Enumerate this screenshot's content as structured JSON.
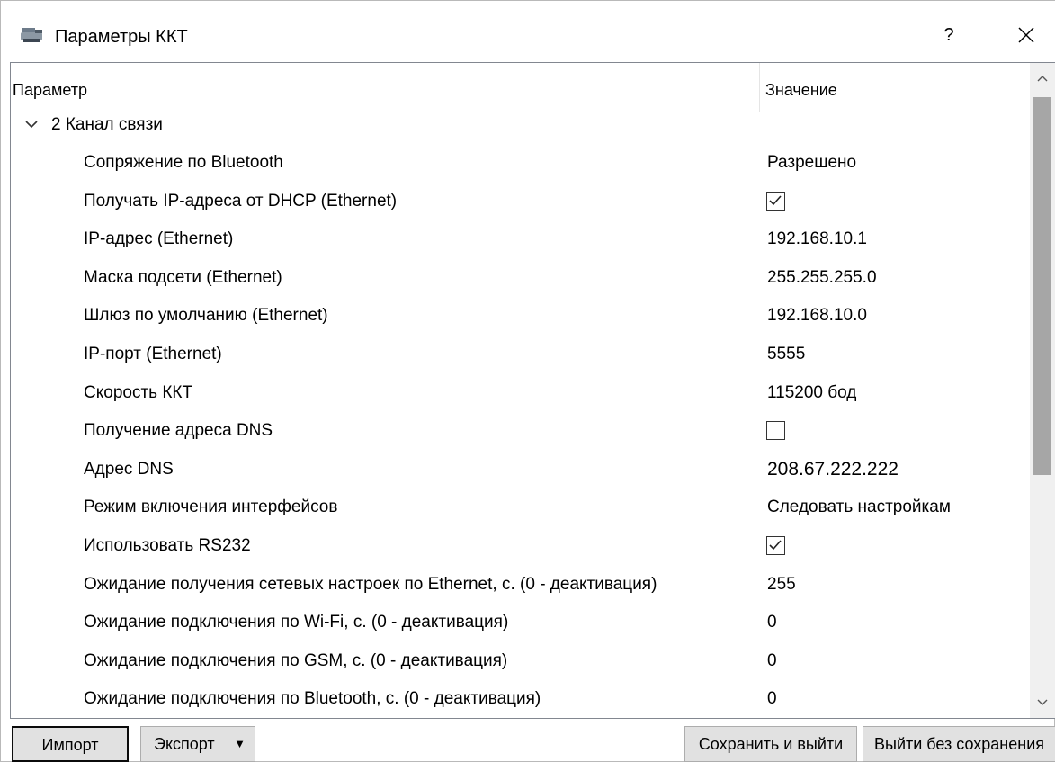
{
  "window": {
    "title": "Параметры ККТ",
    "help_label": "?",
    "close_label": "✕"
  },
  "table": {
    "columns": [
      "Параметр",
      "Значение"
    ],
    "group": {
      "label": "2 Канал связи",
      "expanded": true
    },
    "rows": [
      {
        "name": "Сопряжение по Bluetooth",
        "type": "text",
        "value": "Разрешено"
      },
      {
        "name": "Получать IP-адреса от DHCP (Ethernet)",
        "type": "checkbox",
        "checked": true
      },
      {
        "name": "IP-адрес (Ethernet)",
        "type": "text",
        "value": "192.168.10.1"
      },
      {
        "name": "Маска подсети (Ethernet)",
        "type": "text",
        "value": "255.255.255.0"
      },
      {
        "name": "Шлюз по умолчанию (Ethernet)",
        "type": "text",
        "value": "192.168.10.0"
      },
      {
        "name": "IP-порт (Ethernet)",
        "type": "text",
        "value": "5555"
      },
      {
        "name": "Скорость ККТ",
        "type": "text",
        "value": "115200 бод"
      },
      {
        "name": "Получение адреса DNS",
        "type": "checkbox",
        "checked": false
      },
      {
        "name": "Адрес DNS",
        "type": "text",
        "value": "208.67.222.222"
      },
      {
        "name": "Режим включения интерфейсов",
        "type": "text",
        "value": "Следовать настройкам"
      },
      {
        "name": "Использовать RS232",
        "type": "checkbox",
        "checked": true
      },
      {
        "name": "Ожидание получения сетевых настроек по Ethernet, с. (0 - деактивация)",
        "type": "text",
        "value": "255"
      },
      {
        "name": "Ожидание подключения по Wi-Fi, с. (0 - деактивация)",
        "type": "text",
        "value": "0"
      },
      {
        "name": "Ожидание подключения по GSM, с. (0 - деактивация)",
        "type": "text",
        "value": "0"
      },
      {
        "name": "Ожидание подключения по Bluetooth, с. (0 - деактивация)",
        "type": "text",
        "value": "0"
      }
    ]
  },
  "buttons": {
    "import": "Импорт",
    "export": "Экспорт",
    "export_arrow": "▼",
    "save_exit": "Сохранить и выйти",
    "exit_no_save": "Выйти без сохранения"
  },
  "colors": {
    "border": "#828790",
    "button_bg": "#e1e1e1",
    "scroll_thumb": "#a6a6a6"
  }
}
